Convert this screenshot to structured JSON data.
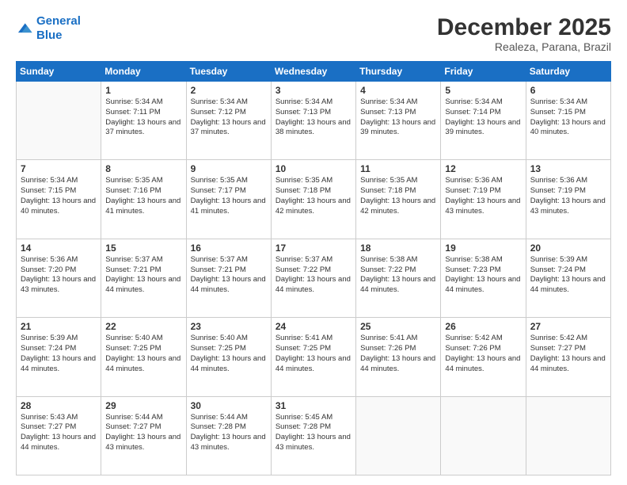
{
  "header": {
    "logo_line1": "General",
    "logo_line2": "Blue",
    "month": "December 2025",
    "location": "Realeza, Parana, Brazil"
  },
  "weekdays": [
    "Sunday",
    "Monday",
    "Tuesday",
    "Wednesday",
    "Thursday",
    "Friday",
    "Saturday"
  ],
  "weeks": [
    [
      {
        "day": "",
        "sunrise": "",
        "sunset": "",
        "daylight": ""
      },
      {
        "day": "1",
        "sunrise": "Sunrise: 5:34 AM",
        "sunset": "Sunset: 7:11 PM",
        "daylight": "Daylight: 13 hours and 37 minutes."
      },
      {
        "day": "2",
        "sunrise": "Sunrise: 5:34 AM",
        "sunset": "Sunset: 7:12 PM",
        "daylight": "Daylight: 13 hours and 37 minutes."
      },
      {
        "day": "3",
        "sunrise": "Sunrise: 5:34 AM",
        "sunset": "Sunset: 7:13 PM",
        "daylight": "Daylight: 13 hours and 38 minutes."
      },
      {
        "day": "4",
        "sunrise": "Sunrise: 5:34 AM",
        "sunset": "Sunset: 7:13 PM",
        "daylight": "Daylight: 13 hours and 39 minutes."
      },
      {
        "day": "5",
        "sunrise": "Sunrise: 5:34 AM",
        "sunset": "Sunset: 7:14 PM",
        "daylight": "Daylight: 13 hours and 39 minutes."
      },
      {
        "day": "6",
        "sunrise": "Sunrise: 5:34 AM",
        "sunset": "Sunset: 7:15 PM",
        "daylight": "Daylight: 13 hours and 40 minutes."
      }
    ],
    [
      {
        "day": "7",
        "sunrise": "Sunrise: 5:34 AM",
        "sunset": "Sunset: 7:15 PM",
        "daylight": "Daylight: 13 hours and 40 minutes."
      },
      {
        "day": "8",
        "sunrise": "Sunrise: 5:35 AM",
        "sunset": "Sunset: 7:16 PM",
        "daylight": "Daylight: 13 hours and 41 minutes."
      },
      {
        "day": "9",
        "sunrise": "Sunrise: 5:35 AM",
        "sunset": "Sunset: 7:17 PM",
        "daylight": "Daylight: 13 hours and 41 minutes."
      },
      {
        "day": "10",
        "sunrise": "Sunrise: 5:35 AM",
        "sunset": "Sunset: 7:18 PM",
        "daylight": "Daylight: 13 hours and 42 minutes."
      },
      {
        "day": "11",
        "sunrise": "Sunrise: 5:35 AM",
        "sunset": "Sunset: 7:18 PM",
        "daylight": "Daylight: 13 hours and 42 minutes."
      },
      {
        "day": "12",
        "sunrise": "Sunrise: 5:36 AM",
        "sunset": "Sunset: 7:19 PM",
        "daylight": "Daylight: 13 hours and 43 minutes."
      },
      {
        "day": "13",
        "sunrise": "Sunrise: 5:36 AM",
        "sunset": "Sunset: 7:19 PM",
        "daylight": "Daylight: 13 hours and 43 minutes."
      }
    ],
    [
      {
        "day": "14",
        "sunrise": "Sunrise: 5:36 AM",
        "sunset": "Sunset: 7:20 PM",
        "daylight": "Daylight: 13 hours and 43 minutes."
      },
      {
        "day": "15",
        "sunrise": "Sunrise: 5:37 AM",
        "sunset": "Sunset: 7:21 PM",
        "daylight": "Daylight: 13 hours and 44 minutes."
      },
      {
        "day": "16",
        "sunrise": "Sunrise: 5:37 AM",
        "sunset": "Sunset: 7:21 PM",
        "daylight": "Daylight: 13 hours and 44 minutes."
      },
      {
        "day": "17",
        "sunrise": "Sunrise: 5:37 AM",
        "sunset": "Sunset: 7:22 PM",
        "daylight": "Daylight: 13 hours and 44 minutes."
      },
      {
        "day": "18",
        "sunrise": "Sunrise: 5:38 AM",
        "sunset": "Sunset: 7:22 PM",
        "daylight": "Daylight: 13 hours and 44 minutes."
      },
      {
        "day": "19",
        "sunrise": "Sunrise: 5:38 AM",
        "sunset": "Sunset: 7:23 PM",
        "daylight": "Daylight: 13 hours and 44 minutes."
      },
      {
        "day": "20",
        "sunrise": "Sunrise: 5:39 AM",
        "sunset": "Sunset: 7:24 PM",
        "daylight": "Daylight: 13 hours and 44 minutes."
      }
    ],
    [
      {
        "day": "21",
        "sunrise": "Sunrise: 5:39 AM",
        "sunset": "Sunset: 7:24 PM",
        "daylight": "Daylight: 13 hours and 44 minutes."
      },
      {
        "day": "22",
        "sunrise": "Sunrise: 5:40 AM",
        "sunset": "Sunset: 7:25 PM",
        "daylight": "Daylight: 13 hours and 44 minutes."
      },
      {
        "day": "23",
        "sunrise": "Sunrise: 5:40 AM",
        "sunset": "Sunset: 7:25 PM",
        "daylight": "Daylight: 13 hours and 44 minutes."
      },
      {
        "day": "24",
        "sunrise": "Sunrise: 5:41 AM",
        "sunset": "Sunset: 7:25 PM",
        "daylight": "Daylight: 13 hours and 44 minutes."
      },
      {
        "day": "25",
        "sunrise": "Sunrise: 5:41 AM",
        "sunset": "Sunset: 7:26 PM",
        "daylight": "Daylight: 13 hours and 44 minutes."
      },
      {
        "day": "26",
        "sunrise": "Sunrise: 5:42 AM",
        "sunset": "Sunset: 7:26 PM",
        "daylight": "Daylight: 13 hours and 44 minutes."
      },
      {
        "day": "27",
        "sunrise": "Sunrise: 5:42 AM",
        "sunset": "Sunset: 7:27 PM",
        "daylight": "Daylight: 13 hours and 44 minutes."
      }
    ],
    [
      {
        "day": "28",
        "sunrise": "Sunrise: 5:43 AM",
        "sunset": "Sunset: 7:27 PM",
        "daylight": "Daylight: 13 hours and 44 minutes."
      },
      {
        "day": "29",
        "sunrise": "Sunrise: 5:44 AM",
        "sunset": "Sunset: 7:27 PM",
        "daylight": "Daylight: 13 hours and 43 minutes."
      },
      {
        "day": "30",
        "sunrise": "Sunrise: 5:44 AM",
        "sunset": "Sunset: 7:28 PM",
        "daylight": "Daylight: 13 hours and 43 minutes."
      },
      {
        "day": "31",
        "sunrise": "Sunrise: 5:45 AM",
        "sunset": "Sunset: 7:28 PM",
        "daylight": "Daylight: 13 hours and 43 minutes."
      },
      {
        "day": "",
        "sunrise": "",
        "sunset": "",
        "daylight": ""
      },
      {
        "day": "",
        "sunrise": "",
        "sunset": "",
        "daylight": ""
      },
      {
        "day": "",
        "sunrise": "",
        "sunset": "",
        "daylight": ""
      }
    ]
  ]
}
